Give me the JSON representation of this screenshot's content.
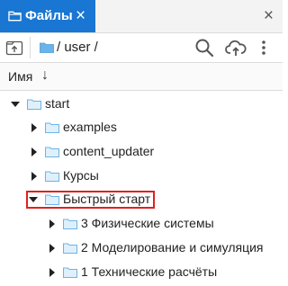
{
  "tab": {
    "title": "Файлы",
    "close_glyph": "×",
    "icon": "folder-icon"
  },
  "panel_close_glyph": "×",
  "toolbar": {
    "path": "/ user /",
    "icons": [
      "folder-up-icon",
      "folder-icon",
      "search-icon",
      "cloud-upload-icon",
      "more-vert-icon"
    ]
  },
  "header": {
    "name_label": "Имя",
    "sort_glyph": "↓"
  },
  "colors": {
    "accent": "#1976d2",
    "folder_outline": "#6bb4e8",
    "folder_fill": "#dff0fb",
    "highlight_border": "#e02020"
  },
  "tree": [
    {
      "label": "start",
      "expanded": true,
      "level": 0
    },
    {
      "label": "examples",
      "expanded": false,
      "level": 1
    },
    {
      "label": "content_updater",
      "expanded": false,
      "level": 1
    },
    {
      "label": "Курсы",
      "expanded": false,
      "level": 1
    },
    {
      "label": "Быстрый старт",
      "expanded": true,
      "level": 1,
      "highlighted": true
    },
    {
      "label": "3 Физические системы",
      "expanded": false,
      "level": 2
    },
    {
      "label": "2 Моделирование и симуляция",
      "expanded": false,
      "level": 2
    },
    {
      "label": "1 Технические расчёты",
      "expanded": false,
      "level": 2
    }
  ]
}
